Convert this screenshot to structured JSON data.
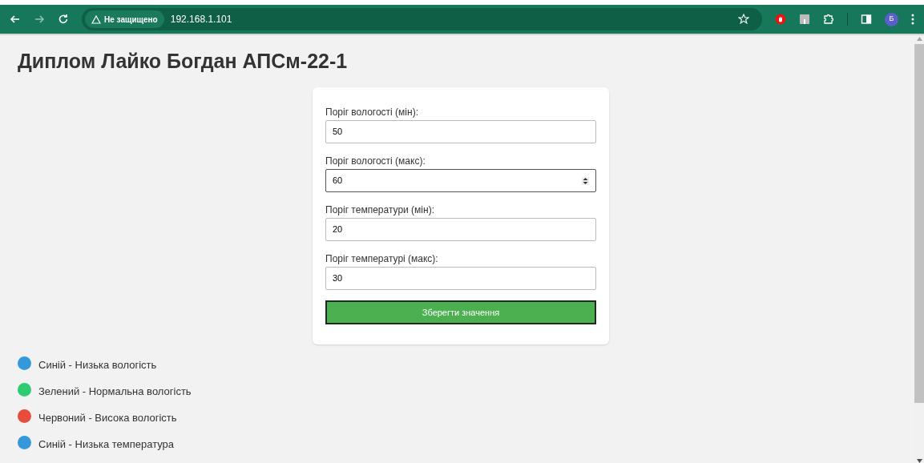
{
  "browser": {
    "security_label": "Не защищено",
    "url": "192.168.1.101",
    "profile_initial": "Б"
  },
  "page": {
    "title": "Диплом Лайко Богдан АПСм-22-1"
  },
  "form": {
    "fields": [
      {
        "label": "Поріг вологості (мін):",
        "value": "50",
        "focused": false
      },
      {
        "label": "Поріг вологості (макс):",
        "value": "60",
        "focused": true
      },
      {
        "label": "Поріг температури (мін):",
        "value": "20",
        "focused": false
      },
      {
        "label": "Поріг температурі (макс):",
        "value": "30",
        "focused": false
      }
    ],
    "submit": "Зберегти значення"
  },
  "legend": [
    {
      "label": "Синій - Низька вологість",
      "color": "#3498db"
    },
    {
      "label": "Зелений - Нормальна вологість",
      "color": "#2ecc71"
    },
    {
      "label": "Червоний - Висока вологість",
      "color": "#e74c3c"
    },
    {
      "label": "Синій - Низька температура",
      "color": "#3498db"
    }
  ]
}
